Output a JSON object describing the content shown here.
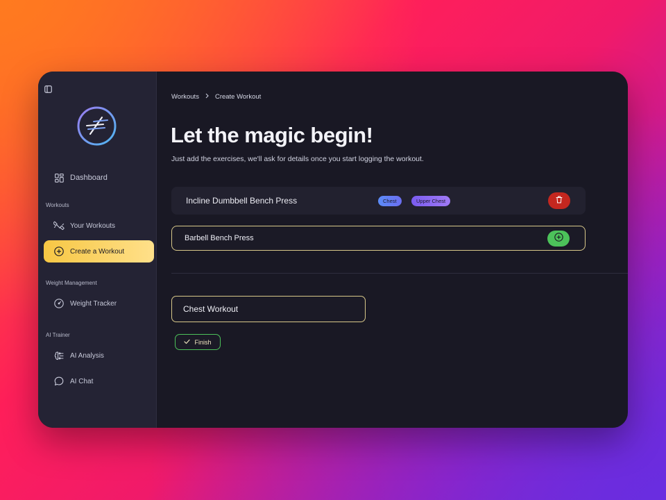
{
  "sidebar": {
    "dashboard": "Dashboard",
    "sections": {
      "workouts": "Workouts",
      "weight": "Weight Management",
      "ai": "AI Trainer"
    },
    "items": {
      "your_workouts": "Your Workouts",
      "create_workout": "Create a Workout",
      "weight_tracker": "Weight Tracker",
      "ai_analysis": "AI Analysis",
      "ai_chat": "AI Chat"
    }
  },
  "breadcrumb": {
    "root": "Workouts",
    "current": "Create Workout"
  },
  "main": {
    "title": "Let the magic begin!",
    "subtitle": "Just add the exercises, we'll ask for details once you start logging the workout.",
    "exercise": {
      "name": "Incline Dumbbell Bench Press",
      "tags": [
        "Chest",
        "Upper Chest"
      ]
    },
    "add_exercise": {
      "name": "Barbell Bench Press"
    },
    "workout_name": "Chest Workout",
    "finish_label": "Finish"
  },
  "colors": {
    "accent_yellow": "#f7c744",
    "delete_red": "#c4271f",
    "add_green": "#4cc25a"
  }
}
